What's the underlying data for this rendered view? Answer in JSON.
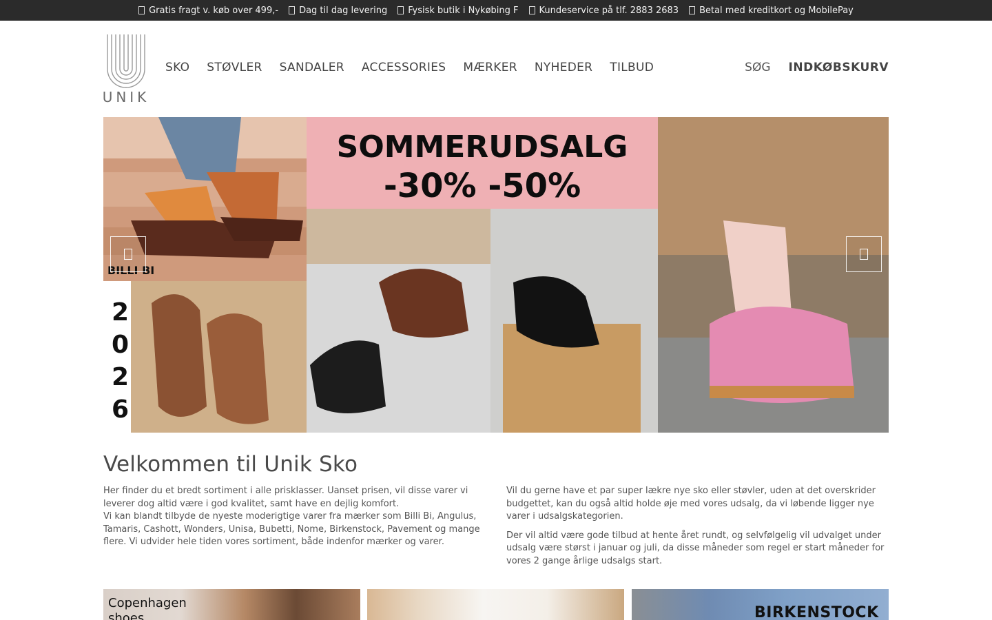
{
  "topbar": {
    "items": [
      {
        "icon": "truck-icon",
        "text": "Gratis fragt v. køb over 499,-"
      },
      {
        "icon": "clock-icon",
        "text": "Dag til dag levering"
      },
      {
        "icon": "store-icon",
        "text": "Fysisk butik i Nykøbing F"
      },
      {
        "icon": "phone-icon",
        "text": "Kundeservice på tlf. 2883 2683"
      },
      {
        "icon": "credit-card-icon",
        "text": "Betal med kreditkort og MobilePay"
      }
    ]
  },
  "header": {
    "logo_text": "UNIK",
    "nav": [
      "SKO",
      "STØVLER",
      "SANDALER",
      "ACCESSORIES",
      "MÆRKER",
      "NYHEDER",
      "TILBUD"
    ],
    "search_label": "SØG",
    "cart_label": "INDKØBSKURV"
  },
  "hero": {
    "headline": "SOMMERUDSALG",
    "discount": "-30% -50%",
    "brand_tag": "BILLI BI",
    "year_digits": [
      "2",
      "0",
      "2",
      "6"
    ],
    "prev_icon": "chevron-left-icon",
    "next_icon": "chevron-right-icon",
    "banner_pink": "#efb0b4"
  },
  "welcome": {
    "title": "Velkommen til Unik Sko",
    "left_paragraphs": [
      "Her finder du et bredt sortiment i alle prisklasser. Uanset prisen, vil disse varer vi leverer dog altid være i god kvalitet, samt have en dejlig komfort.",
      "Vi kan blandt tilbyde de nyeste moderigtige varer fra mærker som Billi Bi, Angulus, Tamaris, Cashott, Wonders, Unisa, Bubetti, Nome, Birkenstock, Pavement og mange flere. Vi udvider hele tiden vores sortiment, både indenfor mærker og varer."
    ],
    "right_paragraphs": [
      "Vil du gerne have et par super lækre nye sko eller støvler, uden at det overskrider budgettet, kan du også altid holde øje med vores udsalg, da vi løbende ligger nye varer i udsalgskategorien.",
      "Der vil altid være gode tilbud at hente året rundt, og selvfølgelig vil udvalget under udsalg være størst i januar og juli, da disse måneder som regel er start måneder for vores 2 gange årlige udsalgs start."
    ]
  },
  "tiles": [
    {
      "label": "Copenhagen shoes"
    },
    {
      "label": ""
    },
    {
      "label": "BIRKENSTOCK"
    }
  ]
}
